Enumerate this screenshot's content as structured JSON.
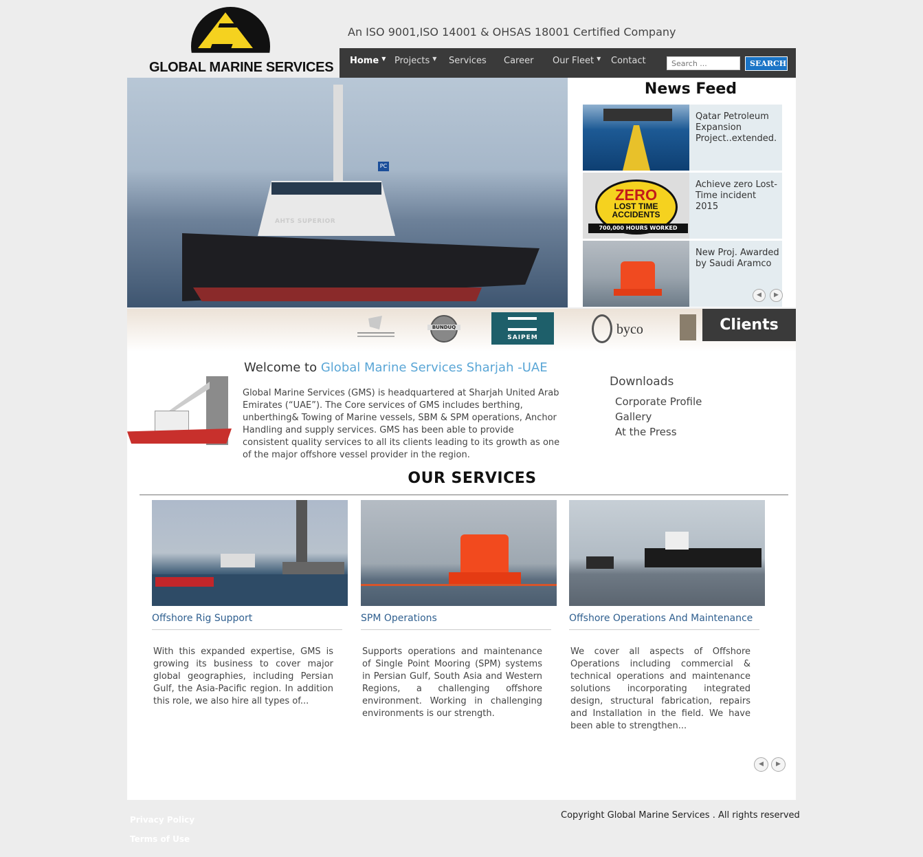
{
  "brand": {
    "name": "GLOBAL MARINE SERVICES",
    "tagline": "An ISO 9001,ISO 14001 & OHSAS 18001 Certified Company"
  },
  "nav": {
    "items": [
      {
        "label": "Home",
        "active": true,
        "dropdown": true
      },
      {
        "label": "Projects",
        "dropdown": true
      },
      {
        "label": "Services"
      },
      {
        "label": "Career"
      },
      {
        "label": "Our Fleet",
        "dropdown": true
      },
      {
        "label": "Contact"
      }
    ],
    "search": {
      "placeholder": "Search ...",
      "button_label": "SEARCH"
    }
  },
  "hero": {
    "ship_label": "AHTS SUPERIOR",
    "pc_label": "PC"
  },
  "news_feed": {
    "title": "News Feed",
    "items": [
      {
        "text": "Qatar Petroleum Expansion Project..extended."
      },
      {
        "text": "Achieve zero Lost-Time incident 2015",
        "badge_lines": [
          "ZERO",
          "LOST TIME",
          "ACCIDENTS",
          "700,000 HOURS WORKED"
        ]
      },
      {
        "text": "New Proj. Awarded by Saudi Aramco"
      }
    ]
  },
  "clients": {
    "label": "Clients",
    "logos": [
      "BUNDUQ",
      "SAIPEM",
      "byco"
    ]
  },
  "welcome": {
    "title_prefix": "Welcome to ",
    "title_highlight": "Global Marine Services Sharjah -UAE",
    "text": "Global Marine Services (GMS) is headquartered at Sharjah United Arab Emirates (“UAE”). The Core services of GMS includes berthing, unberthing& Towing of Marine vessels, SBM & SPM operations, Anchor Handling and supply services. GMS has been able to provide consistent quality services to all its clients leading to its growth as one of the major offshore vessel provider in the region."
  },
  "downloads": {
    "title": "Downloads",
    "links": [
      "Corporate Profile",
      "Gallery",
      "At the Press"
    ]
  },
  "services": {
    "title": "OUR SERVICES",
    "items": [
      {
        "title": "Offshore Rig Support",
        "text": "With this expanded expertise, GMS is growing its business to cover major global geographies, including Persian Gulf, the Asia-Pacific region. In addition this role, we also hire all types of..."
      },
      {
        "title": "SPM Operations",
        "text": "Supports operations and maintenance of Single Point Mooring (SPM) systems in Persian Gulf, South Asia and Western Regions, a challenging offshore environment. Working in challenging environments is our strength."
      },
      {
        "title": "Offshore Operations And Maintenance",
        "text": "We cover all aspects of Offshore Operations including commercial & technical operations and maintenance solutions incorporating integrated design, structural fabrication, repairs and Installation in the field. We have been able to strengthen..."
      }
    ]
  },
  "footer": {
    "copyright": "Copyright Global Marine Services . All rights reserved",
    "links": [
      "Privacy Policy",
      "Terms of Use"
    ]
  },
  "colors": {
    "nav_bg": "#3a3a3a",
    "accent": "#5aa6d6",
    "search_button": "#1a74c6",
    "logo_yellow": "#f5d21f"
  }
}
